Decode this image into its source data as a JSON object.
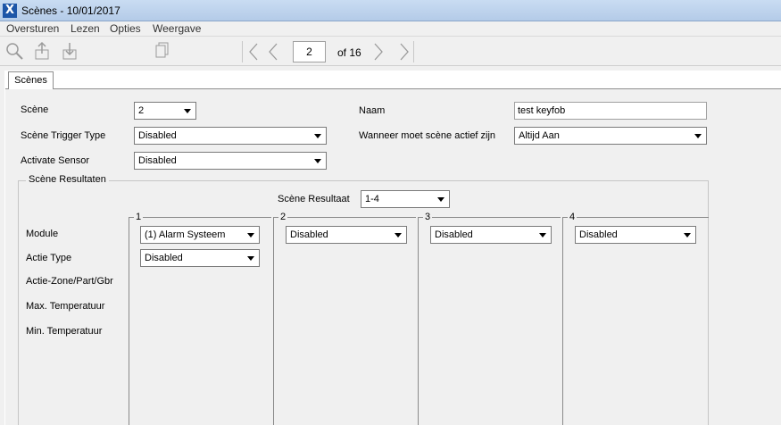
{
  "window": {
    "title": "Scènes - 10/01/2017"
  },
  "menu": [
    "Oversturen",
    "Lezen",
    "Opties",
    "Weergave"
  ],
  "toolbar": {
    "icons": [
      "search-icon",
      "upload-icon",
      "download-icon",
      "copy-icon",
      "first-page-icon",
      "previous-page-icon",
      "next-page-icon",
      "last-page-icon"
    ],
    "page_current": "2",
    "page_of": "of 16"
  },
  "tabs": [
    "Scènes"
  ],
  "form": {
    "scene_label": "Scène",
    "scene_value": "2",
    "trigger_label": "Scène Trigger Type",
    "trigger_value": "Disabled",
    "sensor_label": "Activate Sensor",
    "sensor_value": "Disabled",
    "name_label": "Naam",
    "name_value": "test keyfob",
    "active_label": "Wanneer moet scène actief zijn",
    "active_value": "Altijd Aan"
  },
  "results": {
    "group_title": "Scène Resultaten",
    "result_label": "Scène Resultaat",
    "result_value": "1-4",
    "row_labels": [
      "Module",
      "Actie Type",
      "Actie-Zone/Part/Gbr",
      "Max. Temperatuur",
      "Min. Temperatuur"
    ],
    "columns": [
      {
        "number": "1",
        "module": "(1) Alarm Systeem",
        "action_type": "Disabled"
      },
      {
        "number": "2",
        "module": "Disabled"
      },
      {
        "number": "3",
        "module": "Disabled"
      },
      {
        "number": "4",
        "module": "Disabled"
      }
    ]
  }
}
